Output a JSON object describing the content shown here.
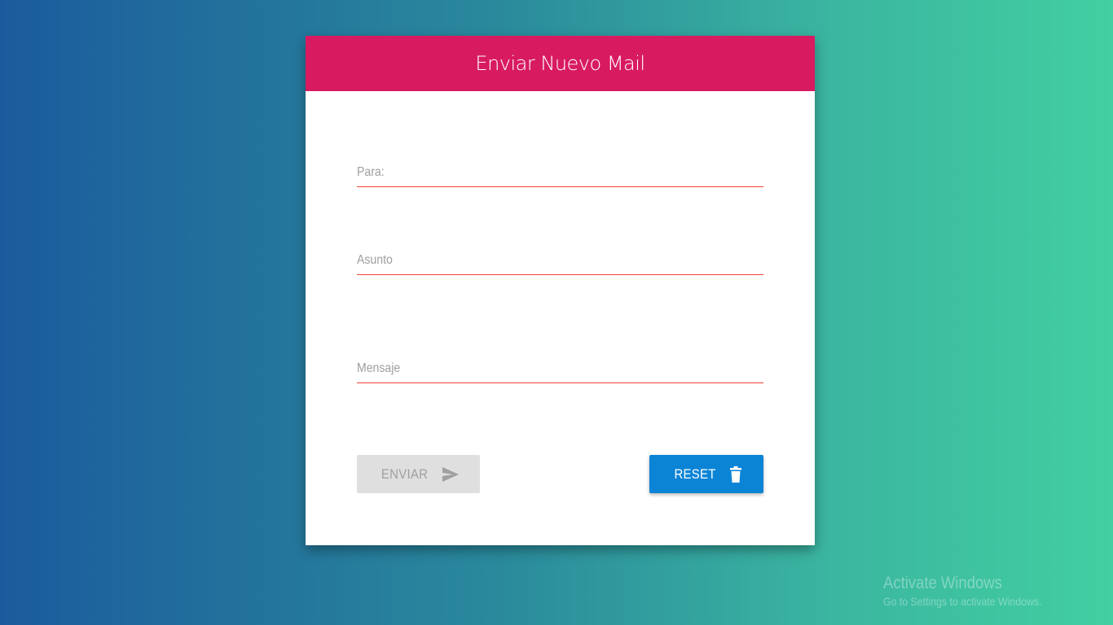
{
  "form": {
    "title": "Enviar Nuevo Mail",
    "fields": {
      "para": {
        "label": "Para:",
        "value": ""
      },
      "asunto": {
        "label": "Asunto",
        "value": ""
      },
      "mensaje": {
        "label": "Mensaje",
        "value": ""
      }
    },
    "buttons": {
      "enviar": {
        "label": "ENVIAR",
        "icon": "send-icon",
        "disabled": true
      },
      "reset": {
        "label": "RESET",
        "icon": "trash-icon"
      }
    }
  },
  "colors": {
    "header": "#d81b60",
    "underline": "#f44336",
    "reset_button": "#0b84d6",
    "enviar_button_disabled": "#dfdfdf"
  },
  "watermark": {
    "title": "Activate Windows",
    "subtitle": "Go to Settings to activate Windows."
  }
}
